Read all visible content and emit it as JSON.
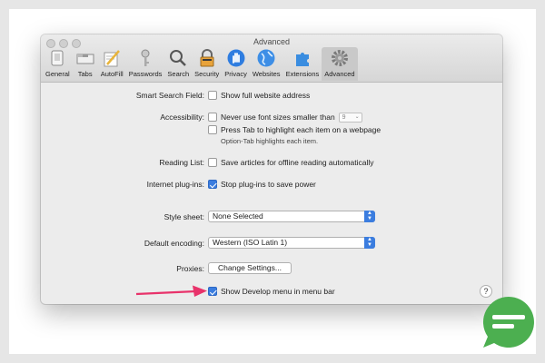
{
  "window": {
    "title": "Advanced"
  },
  "toolbar": {
    "items": [
      {
        "label": "General",
        "icon": "general-icon"
      },
      {
        "label": "Tabs",
        "icon": "tabs-icon"
      },
      {
        "label": "AutoFill",
        "icon": "autofill-icon"
      },
      {
        "label": "Passwords",
        "icon": "key-icon"
      },
      {
        "label": "Search",
        "icon": "magnifier-icon"
      },
      {
        "label": "Security",
        "icon": "lock-icon"
      },
      {
        "label": "Privacy",
        "icon": "hand-icon"
      },
      {
        "label": "Websites",
        "icon": "globe-icon"
      },
      {
        "label": "Extensions",
        "icon": "puzzle-icon"
      },
      {
        "label": "Advanced",
        "icon": "gear-icon"
      }
    ],
    "active": "Advanced"
  },
  "settings": {
    "smart_search": {
      "label": "Smart Search Field:",
      "option": "Show full website address",
      "checked": false
    },
    "accessibility": {
      "label": "Accessibility:",
      "font_option": "Never use font sizes smaller than",
      "font_size_value": "9",
      "tab_option": "Press Tab to highlight each item on a webpage",
      "tab_note": "Option-Tab highlights each item.",
      "font_checked": false,
      "tab_checked": false
    },
    "reading_list": {
      "label": "Reading List:",
      "option": "Save articles for offline reading automatically",
      "checked": false
    },
    "plugins": {
      "label": "Internet plug-ins:",
      "option": "Stop plug-ins to save power",
      "checked": true
    },
    "style_sheet": {
      "label": "Style sheet:",
      "value": "None Selected"
    },
    "encoding": {
      "label": "Default encoding:",
      "value": "Western (ISO Latin 1)"
    },
    "proxies": {
      "label": "Proxies:",
      "button": "Change Settings..."
    },
    "develop": {
      "option": "Show Develop menu in menu bar",
      "checked": true
    },
    "help": "?"
  },
  "colors": {
    "accent": "#3b7ddf",
    "arrow": "#e8336b",
    "logo": "#4caf50"
  }
}
